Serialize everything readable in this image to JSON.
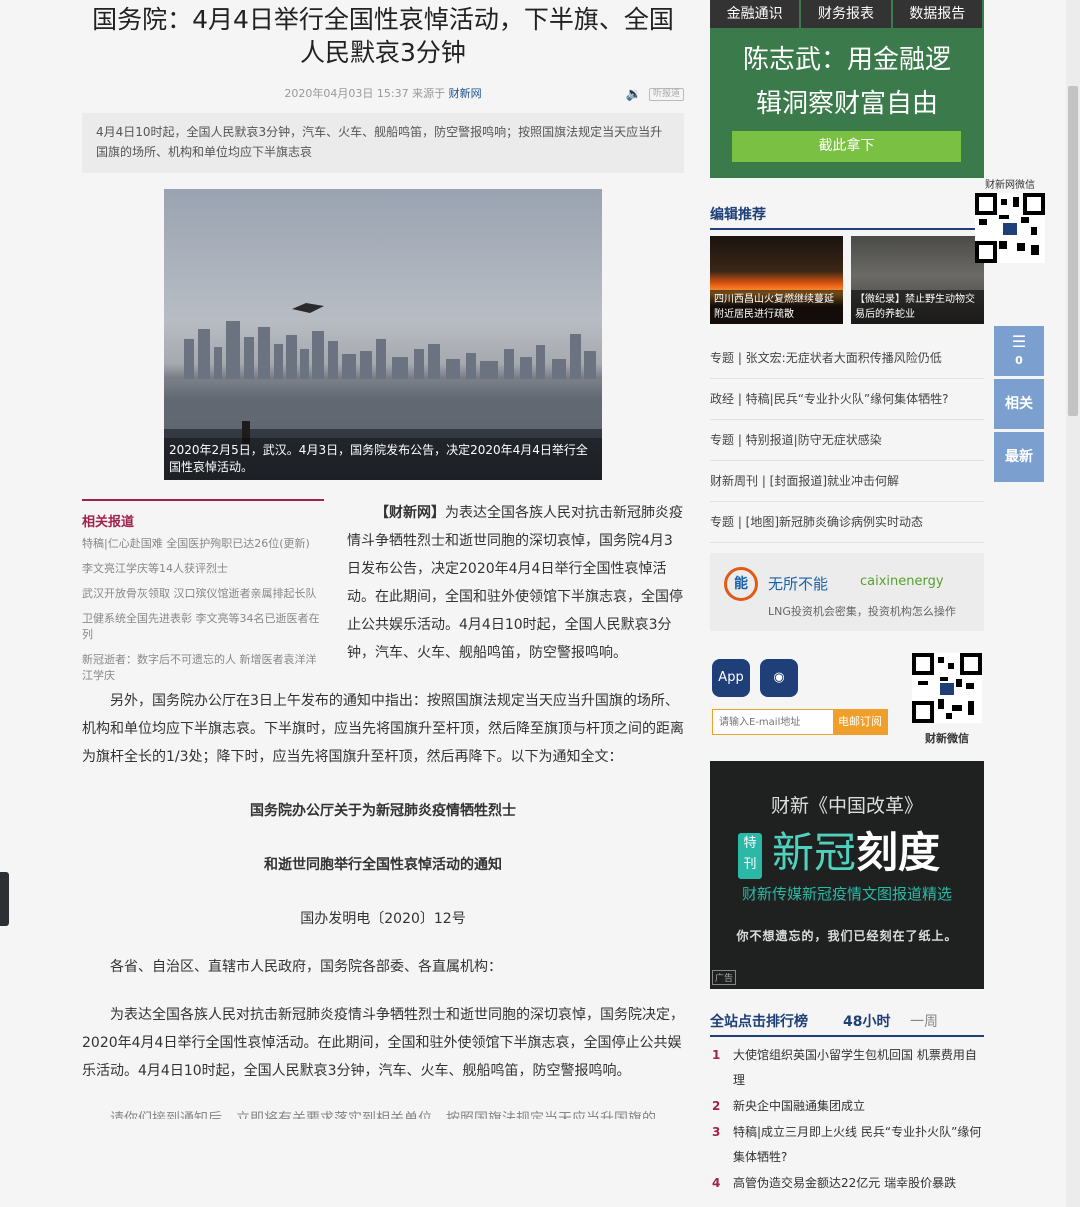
{
  "article": {
    "title": "国务院：4月4日举行全国性哀悼活动，下半旗、全国人民默哀3分钟",
    "date": "2020年04月03日 15:37",
    "source_prefix": "来源于",
    "source": "财新网",
    "listen_label": "听报道",
    "summary": "4月4日10时起，全国人民默哀3分钟，汽车、火车、舰船鸣笛，防空警报鸣响；按照国旗法规定当天应当升国旗的场所、机构和单位均应下半旗志哀",
    "photo_caption": "2020年2月5日，武汉。4月3日，国务院发布公告，决定2020年4月4日举行全国性哀悼活动。",
    "lead_source": "【财新网】",
    "lead_text": "为表达全国各族人民对抗击新冠肺炎疫情斗争牺牲烈士和逝世同胞的深切哀悼，国务院4月3日发布公告，决定2020年4月4日举行全国性哀悼活动。在此期间，全国和驻外使领馆下半旗志哀，全国停止公共娱乐活动。4月4日10时起，全国人民默哀3分钟，汽车、火车、舰船鸣笛，防空警报鸣响。",
    "para2": "另外，国务院办公厅在3日上午发布的通知中指出：按照国旗法规定当天应当升国旗的场所、机构和单位均应下半旗志哀。下半旗时，应当先将国旗升至杆顶，然后降至旗顶与杆顶之间的距离为旗杆全长的1/3处；降下时，应当先将国旗升至杆顶，然后再降下。以下为通知全文：",
    "notice_title_1": "国务院办公厅关于为新冠肺炎疫情牺牲烈士",
    "notice_title_2": "和逝世同胞举行全国性哀悼活动的通知",
    "notice_no": "国办发明电〔2020〕12号",
    "salutation": "各省、自治区、直辖市人民政府，国务院各部委、各直属机构：",
    "para3": "为表达全国各族人民对抗击新冠肺炎疫情斗争牺牲烈士和逝世同胞的深切哀悼，国务院决定，2020年4月4日举行全国性哀悼活动。在此期间，全国和驻外使领馆下半旗志哀，全国停止公共娱乐活动。4月4日10时起，全国人民默哀3分钟，汽车、火车、舰船鸣笛，防空警报鸣响。",
    "para4": "请你们接到通知后，立即将有关要求落实到相关单位，按照国旗法规定当天应当升国旗的"
  },
  "related": {
    "title": "相关报道",
    "items": [
      "特稿|仁心赴国难 全国医护殉职已达26位(更新)",
      "李文亮江学庆等14人获评烈士",
      "武汉开放骨灰领取 汉口殡仪馆逝者亲属排起长队",
      "卫健系统全国先进表彰 李文亮等34名已逝医者在列",
      "新冠逝者：数字后不可遗忘的人 新增医者袁洋洋江学庆"
    ]
  },
  "sidebar": {
    "tabs": [
      "金融通识",
      "财务报表",
      "数据报告"
    ],
    "banner_line1": "陈志武：用金融逻",
    "banner_line2": "辑洞察财富自由",
    "banner_cta": "截此拿下",
    "editor_title": "编辑推荐",
    "thumbs": [
      "四川西昌山火复燃继续蔓延 附近居民进行疏散",
      "【微纪录】禁止野生动物交易后的养蛇业"
    ],
    "news": [
      "专题 | 张文宏:无症状者大面积传播风险仍低",
      "政经 | 特稿|民兵“专业扑火队”缘何集体牺牲?",
      "专题 | 特别报道|防守无症状感染",
      "财新周刊 | [封面报道]就业冲击何解",
      "专题 | [地图]新冠肺炎确诊病例实时动态"
    ],
    "ad_logo": "能",
    "ad_text1": "无所不能",
    "ad_text2": "caixinenergy",
    "ad_text3": "LNG投资机会密集，投资机构怎么操作",
    "app_label": "App",
    "email_placeholder": "请输入E-mail地址",
    "email_subscribe": "电邮订阅",
    "wechat_label": "财新微信",
    "reform_line1": "财新《中国改革》",
    "reform_tag": "特刊",
    "reform_big_a": "新冠",
    "reform_big_b": "刻度",
    "reform_line3": "财新传媒新冠疫情文图报道精选",
    "reform_line4": "你不想遗忘的，我们已经刻在了纸上。",
    "ad_tag": "广告",
    "rank_title": "全站点击排行榜",
    "rank_tab1": "48小时",
    "rank_tab2": "一周",
    "rank": [
      "大使馆组织英国小留学生包机回国 机票费用自理",
      "新央企中国融通集团成立",
      "特稿|成立三月即上火线 民兵“专业扑火队”缘何集体牺牲?",
      "高管伪造交易金额达22亿元 瑞幸股价暴跌"
    ]
  },
  "float": {
    "qr_label": "财新网微信",
    "comment_count": "0",
    "related_btn": "相关",
    "latest_btn": "最新"
  }
}
